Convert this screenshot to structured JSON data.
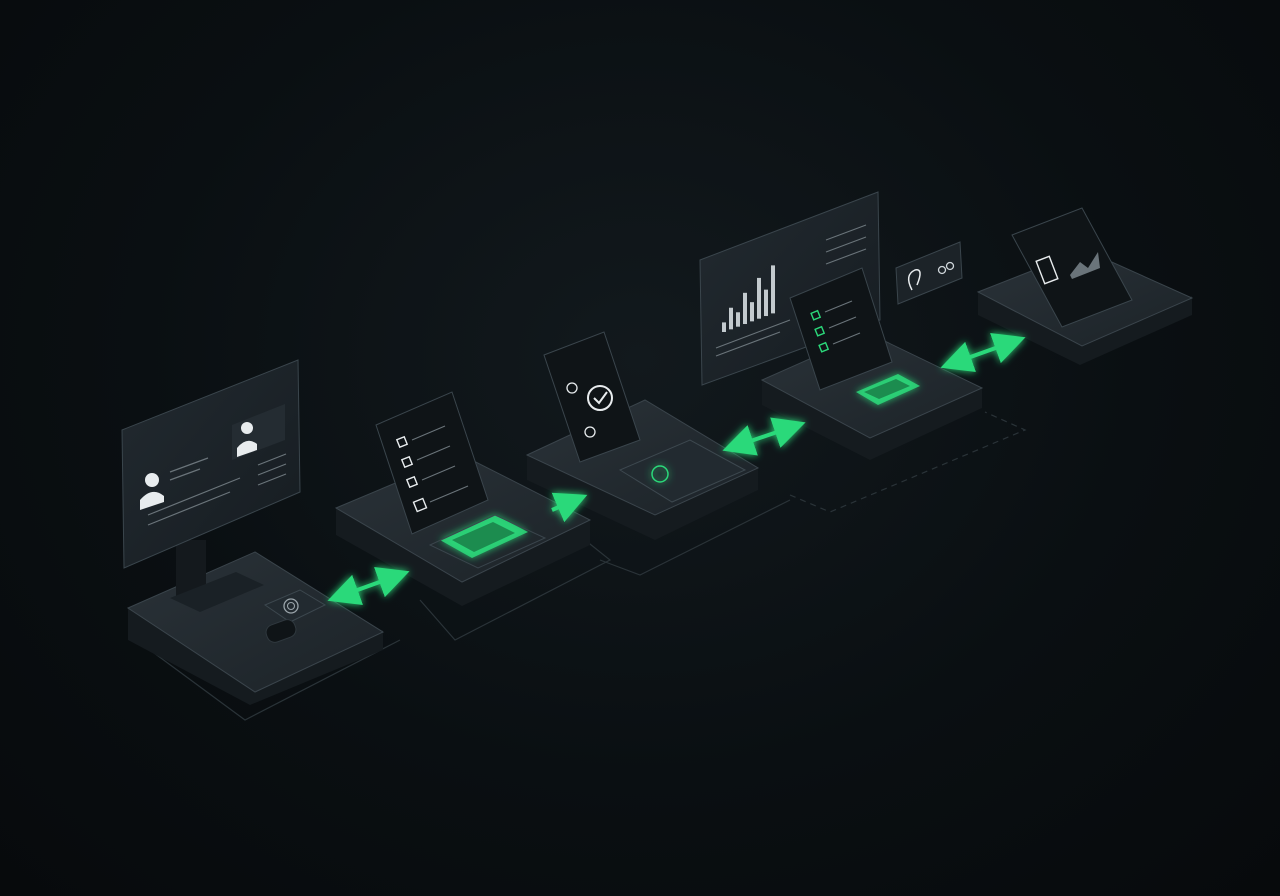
{
  "colors": {
    "background": "#0a0f12",
    "accent": "#2bd97a",
    "panel": "#1c2329",
    "panel_edge": "#2c353c",
    "screen": "#1a2026",
    "screen_text": "#b9c2c8"
  },
  "stations": [
    {
      "id": "enrollment",
      "base_label_1": "",
      "base_label_2": "",
      "screen_header": "",
      "icon": "user-icon"
    },
    {
      "id": "checklist",
      "screen_header": "",
      "icon": "checkbox-icon"
    },
    {
      "id": "verification",
      "screen_header": "",
      "icon": "check-circle-icon"
    },
    {
      "id": "analytics",
      "screen_header": "",
      "icon": "bar-chart-icon"
    },
    {
      "id": "approval",
      "screen_header": "",
      "icon": "checkbox-icon"
    },
    {
      "id": "report",
      "screen_header": "",
      "icon": "document-chart-icon"
    }
  ],
  "connectors": [
    {
      "from": "enrollment",
      "to": "checklist",
      "style": "double-arrow",
      "color": "#2bd97a"
    },
    {
      "from": "checklist",
      "to": "verification",
      "style": "arrow",
      "color": "#2bd97a"
    },
    {
      "from": "verification",
      "to": "approval",
      "style": "double-arrow",
      "color": "#2bd97a"
    },
    {
      "from": "approval",
      "to": "report",
      "style": "double-arrow",
      "color": "#2bd97a"
    }
  ],
  "analytics_chart": {
    "bar_levels": [
      0.2,
      0.45,
      0.3,
      0.65,
      0.4,
      0.85,
      0.55,
      1.0
    ]
  },
  "icons": [
    "user-icon",
    "fingerprint-icon",
    "checkbox-icon",
    "check-circle-icon",
    "bar-chart-icon",
    "signature-icon",
    "link-icon",
    "document-chart-icon",
    "arrow-icon"
  ]
}
